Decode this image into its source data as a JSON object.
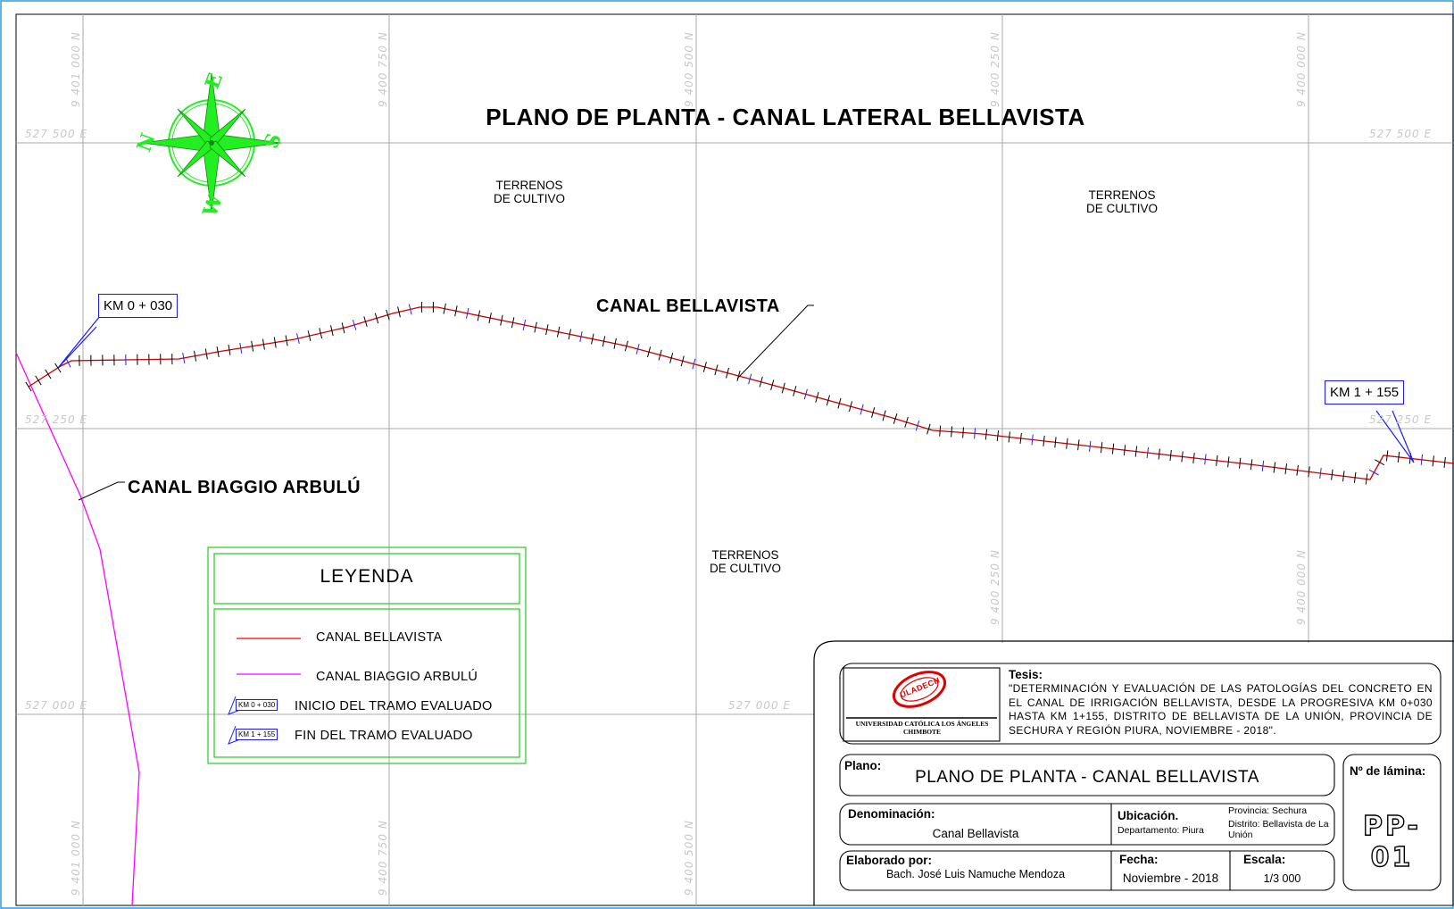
{
  "title": "PLANO DE PLANTA - CANAL LATERAL BELLAVISTA",
  "area_labels": [
    "TERRENOS\nDE CULTIVO",
    "TERRENOS\nDE CULTIVO",
    "TERRENOS\nDE CULTIVO"
  ],
  "canal_labels": {
    "bellavista": "CANAL BELLAVISTA",
    "biaggio": "CANAL BIAGGIO ARBULÚ"
  },
  "km_markers": {
    "start": "KM 0 + 030",
    "end": "KM 1 + 155"
  },
  "compass": {
    "icon": "compass-rose-icon",
    "north": "N",
    "east": "E",
    "south": "S",
    "west": "W",
    "color": "#22ee22"
  },
  "grid": {
    "northings_top": [
      "9 401 000 N",
      "9 400 750 N",
      "9 400 500 N",
      "9 400 250 N",
      "9 400 000 N"
    ],
    "northings_bottom": [
      "9 401 000 N",
      "9 400 750 N",
      "9 400 500 N",
      "9 400 250 N",
      "9 400 000 N"
    ],
    "eastings_left": [
      "527 500 E",
      "527 250 E",
      "527 000 E"
    ],
    "eastings_right": [
      "527 500 E",
      "527 250 E"
    ],
    "easting_mid": "527 000 E"
  },
  "legend": {
    "title": "LEYENDA",
    "items": [
      {
        "label": "CANAL BELLAVISTA",
        "swatch": "#ff0000"
      },
      {
        "label": "CANAL BIAGGIO ARBULÚ",
        "swatch": "#ff00ff"
      },
      {
        "label": "INICIO DEL TRAMO EVALUADO",
        "marker": "KM 0 + 030"
      },
      {
        "label": "FIN DEL TRAMO EVALUADO",
        "marker": "KM 1 + 155"
      }
    ],
    "border_color": "#22cc22"
  },
  "title_block": {
    "logo_text": "ULADECH",
    "university": "UNIVERSIDAD CATÓLICA LOS ÁNGELES",
    "city": "CHIMBOTE",
    "tesis_label": "Tesis:",
    "tesis_text": "\"DETERMINACIÓN Y EVALUACIÓN DE LAS PATOLOGÍAS DEL CONCRETO EN EL CANAL DE IRRIGACIÓN BELLAVISTA, DESDE LA PROGRESIVA KM 0+030 HASTA KM 1+155, DISTRITO DE BELLAVISTA DE LA UNIÓN, PROVINCIA DE SECHURA Y REGIÓN PIURA, NOVIEMBRE - 2018\".",
    "plano_label": "Plano:",
    "plano_value": "PLANO DE PLANTA - CANAL BELLAVISTA",
    "lamina_label": "Nº de lámina:",
    "lamina_value": "PP-01",
    "denominacion_label": "Denominación:",
    "denominacion_value": "Canal Bellavista",
    "ubicacion_label": "Ubicación.",
    "departamento": "Departamento: Piura",
    "provincia": "Provincia: Sechura",
    "distrito": "Distrito: Bellavista de La Unión",
    "elaborado_label": "Elaborado por:",
    "elaborado_value": "Bach. José Luis Namuche Mendoza",
    "fecha_label": "Fecha:",
    "fecha_value": "Noviembre - 2018",
    "escala_label": "Escala:",
    "escala_value": "1/3 000"
  },
  "colors": {
    "canal_bellavista": "#cc0000",
    "canal_biaggio": "#ff00ff",
    "km_marker": "#1a1aff",
    "grid": "#a0a0a0",
    "frame": "#2e9bd6"
  }
}
